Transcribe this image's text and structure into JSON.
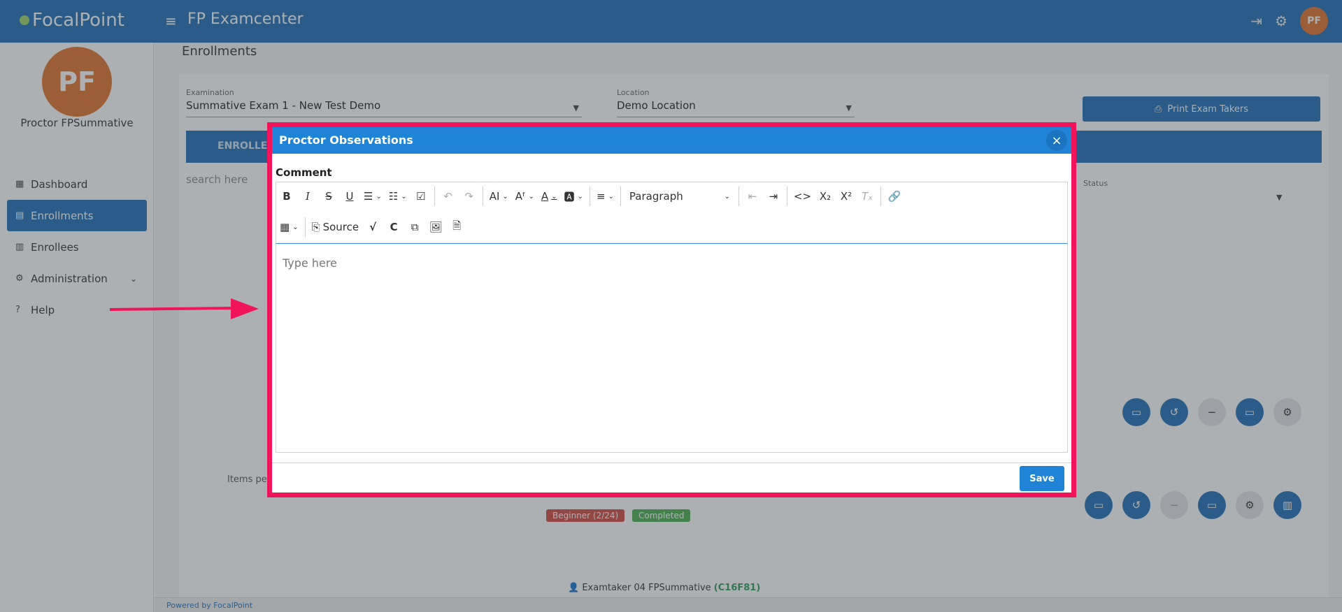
{
  "app": {
    "logo_text": "FocalPoint",
    "title": "FP Examcenter",
    "user_initials": "PF"
  },
  "sidebar": {
    "avatar_initials": "PF",
    "proctor_name": "Proctor FPSummative",
    "items": [
      {
        "label": "Dashboard",
        "icon": "dashboard-icon"
      },
      {
        "label": "Enrollments",
        "icon": "enrollments-icon",
        "active": true
      },
      {
        "label": "Enrollees",
        "icon": "enrollees-icon"
      },
      {
        "label": "Administration",
        "icon": "gear-icon"
      },
      {
        "label": "Help",
        "icon": "help-icon"
      }
    ]
  },
  "main": {
    "page_title": "Enrollments",
    "examination_label": "Examination",
    "examination_value": "Summative Exam 1 - New Test Demo",
    "location_label": "Location",
    "location_value": "Demo Location",
    "print_button": "Print Exam Takers",
    "tab_label": "ENROLLEES",
    "search_placeholder": "search here",
    "status_label": "Status",
    "items_per_page_label": "Items per",
    "badges": [
      {
        "label": "Beginner",
        "count": "(2/24)",
        "color": "#d24a43"
      },
      {
        "label": "Completed",
        "color": "#4caf50"
      }
    ],
    "examtaker_name": "Examtaker 04 FPSummative",
    "examtaker_code": "(C16F81)",
    "footer": "Powered by FocalPoint"
  },
  "modal": {
    "title": "Proctor Observations",
    "comment_label": "Comment",
    "paragraph_select": "Paragraph",
    "source_label": "Source",
    "editor_placeholder": "Type here",
    "save_label": "Save"
  },
  "colors": {
    "primary": "#1f6fb8",
    "modal_header": "#1f84d6",
    "highlight": "#f0145a",
    "avatar": "#e0722a"
  }
}
